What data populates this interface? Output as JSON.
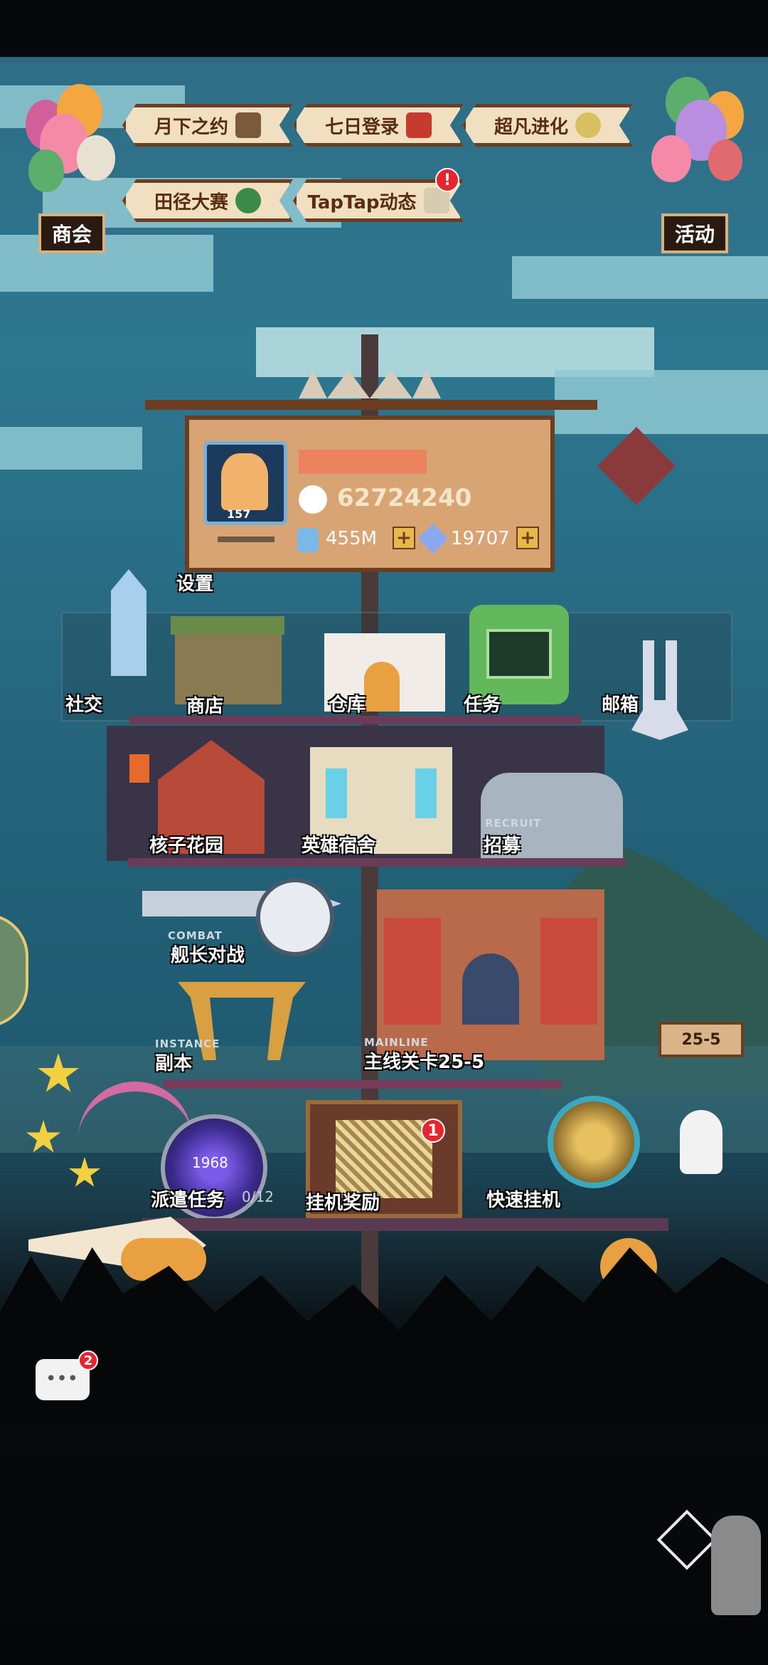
{
  "top_events": [
    {
      "label": "月下之约"
    },
    {
      "label": "七日登录"
    },
    {
      "label": "超凡进化"
    },
    {
      "label": "田径大赛"
    },
    {
      "label": "TapTap动态",
      "badge": "!"
    }
  ],
  "balloons": {
    "left_label": "商会",
    "right_label": "活动"
  },
  "profile": {
    "level": "157",
    "coins": "62724240",
    "potion": "455M",
    "gems": "19707",
    "settings_label": "设置"
  },
  "buildings": {
    "social": "社交",
    "shop": "商店",
    "warehouse": "仓库",
    "tasks": "任务",
    "mailbox": "邮箱",
    "core_garden": "核子花园",
    "hero_dorm": "英雄宿舍",
    "recruit_tag": "RECRUIT",
    "recruit": "招募",
    "combat_tag": "COMBAT",
    "captain_battle": "舰长对战",
    "instance_tag": "INSTANCE",
    "instance": "副本",
    "mainline_tag": "MAINLINE",
    "mainline": "主线关卡25-5",
    "stage_sign": "25-5",
    "portal_count": "1968",
    "dispatch": "派遣任务",
    "dispatch_progress": "0/12",
    "idle_reward": "挂机奖励",
    "idle_badge": "1",
    "quick_idle": "快速挂机"
  },
  "chat": {
    "badge": "2"
  },
  "colors": {
    "ribbon": "#f0dfc0",
    "ribbon_border": "#6b3e22",
    "badge": "#e8242c",
    "sky": "#2d7790",
    "gold": "#f2c14e"
  }
}
